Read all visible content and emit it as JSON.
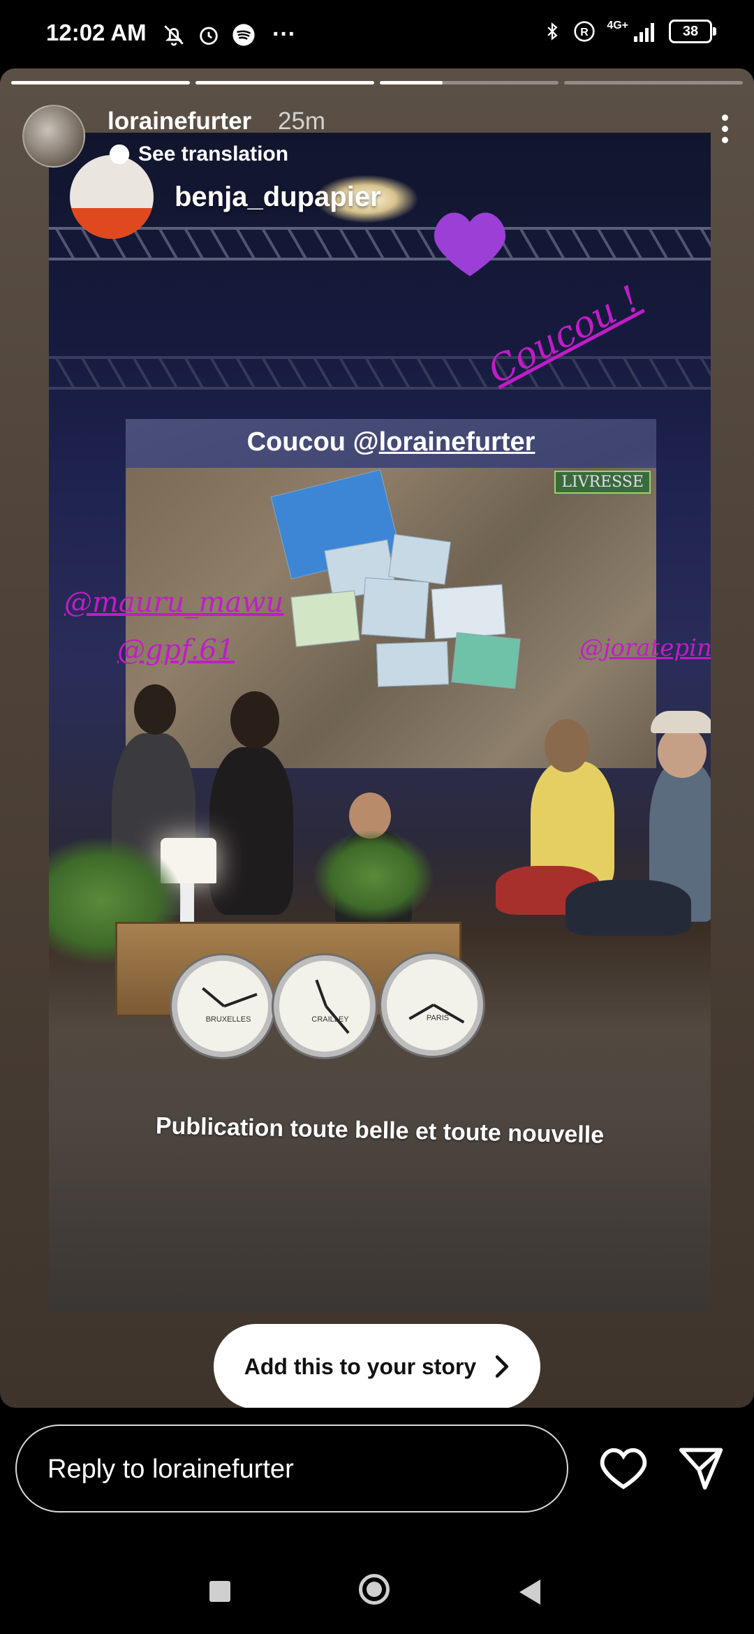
{
  "status_bar": {
    "time": "12:02 AM",
    "network": "4G+",
    "battery": "38"
  },
  "story": {
    "progress_total": 4,
    "progress_done": 2,
    "author": "lorainefurter",
    "time_ago": "25m",
    "see_translation": "See translation",
    "mention_username": "benja_dupapier",
    "screen_title_prefix": "Coucou @",
    "screen_title_mention": "lorainefurter",
    "screen_logo": "LIVRESSE",
    "handwriting": "Coucou !",
    "tag_1": "@mauru_mawu",
    "tag_2": "@gpf.61",
    "tag_3": "@joratepin",
    "clock_1": "BRUXELLES",
    "clock_2": "CRAILLEY",
    "clock_3": "PARIS",
    "caption": "Publication toute belle et toute nouvelle",
    "add_to_story": "Add this to your story"
  },
  "reply": {
    "placeholder": "Reply to lorainefurter"
  },
  "colors": {
    "sticker_pink": "#c21cc7",
    "heart_purple": "#9b3fd6"
  },
  "icons": [
    "bell-off-icon",
    "alarm-icon",
    "spotify-icon",
    "bluetooth-icon",
    "registered-icon",
    "signal-icon",
    "battery-icon",
    "more-vertical-icon",
    "translate-icon",
    "chevron-right-icon",
    "heart-icon",
    "send-icon"
  ]
}
